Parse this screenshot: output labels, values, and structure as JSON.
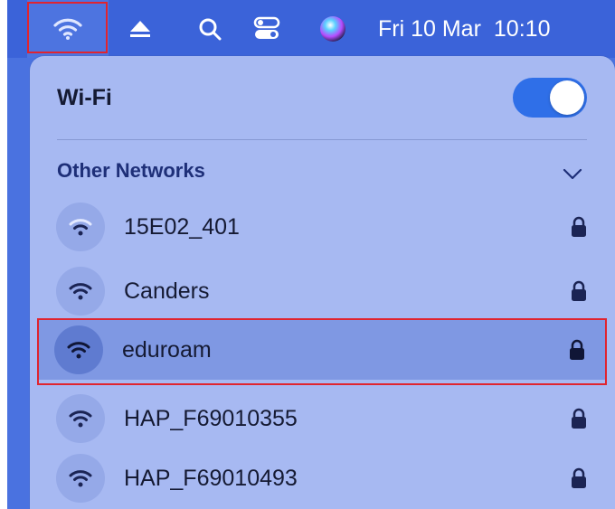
{
  "menubar": {
    "icons": {
      "wifi": "wifi-icon",
      "eject": "eject-icon",
      "search": "search-icon",
      "control_center": "control-center-icon",
      "siri": "siri-icon"
    },
    "date": "Fri 10 Mar",
    "time": "10:10"
  },
  "wifi_panel": {
    "title": "Wi-Fi",
    "toggle_on": true,
    "other_networks_label": "Other Networks",
    "networks": [
      {
        "name": "15E02_401",
        "secured": true,
        "selected": false
      },
      {
        "name": "Canders",
        "secured": true,
        "selected": false
      },
      {
        "name": "eduroam",
        "secured": true,
        "selected": true
      },
      {
        "name": "HAP_F69010355",
        "secured": true,
        "selected": false
      },
      {
        "name": "HAP_F69010493",
        "secured": true,
        "selected": false
      }
    ]
  },
  "colors": {
    "menubar": "#3b63d9",
    "panel": "#a7b9f2",
    "toggle": "#2f6fe8",
    "highlight_outline": "#e0242f",
    "selected_row": "#7f98e3"
  }
}
